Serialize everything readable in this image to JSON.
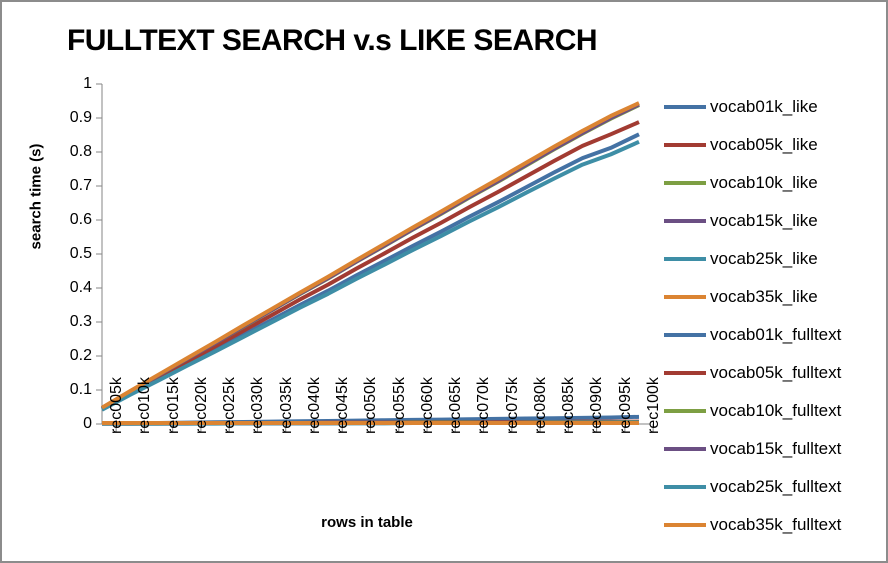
{
  "chart_data": {
    "type": "line",
    "title": "FULLTEXT SEARCH v.s LIKE SEARCH",
    "xlabel": "rows in table",
    "ylabel": "search time (s)",
    "ylim": [
      0,
      1
    ],
    "ytick_labels": [
      "1",
      "0.9",
      "0.8",
      "0.7",
      "0.6",
      "0.5",
      "0.4",
      "0.3",
      "0.2",
      "0.1",
      "0"
    ],
    "ytick_values": [
      1,
      0.9,
      0.8,
      0.7,
      0.6,
      0.5,
      0.4,
      0.3,
      0.2,
      0.1,
      0
    ],
    "grid": false,
    "legend_position": "right",
    "categories": [
      "rec005k",
      "rec010k",
      "rec015k",
      "rec020k",
      "rec025k",
      "rec030k",
      "rec035k",
      "rec040k",
      "rec045k",
      "rec050k",
      "rec055k",
      "rec060k",
      "rec065k",
      "rec070k",
      "rec075k",
      "rec080k",
      "rec085k",
      "rec090k",
      "rec095k",
      "rec100k"
    ],
    "series": [
      {
        "name": "vocab01k_like",
        "color": "#4472A4",
        "values": [
          0.043,
          0.088,
          0.131,
          0.175,
          0.218,
          0.262,
          0.306,
          0.35,
          0.392,
          0.437,
          0.48,
          0.524,
          0.566,
          0.61,
          0.652,
          0.696,
          0.74,
          0.782,
          0.812,
          0.852
        ]
      },
      {
        "name": "vocab05k_like",
        "color": "#A23B32",
        "values": [
          0.045,
          0.092,
          0.137,
          0.183,
          0.228,
          0.274,
          0.32,
          0.366,
          0.41,
          0.457,
          0.502,
          0.548,
          0.592,
          0.638,
          0.682,
          0.728,
          0.774,
          0.818,
          0.852,
          0.888
        ]
      },
      {
        "name": "vocab10k_like",
        "color": "#7D9F43",
        "values": [
          0.047,
          0.096,
          0.143,
          0.191,
          0.238,
          0.286,
          0.334,
          0.382,
          0.428,
          0.477,
          0.524,
          0.572,
          0.618,
          0.666,
          0.712,
          0.76,
          0.808,
          0.854,
          0.898,
          0.938
        ]
      },
      {
        "name": "vocab15k_like",
        "color": "#6B4F83",
        "values": [
          0.047,
          0.096,
          0.143,
          0.191,
          0.238,
          0.287,
          0.335,
          0.383,
          0.429,
          0.478,
          0.525,
          0.573,
          0.62,
          0.668,
          0.714,
          0.762,
          0.81,
          0.856,
          0.9,
          0.94
        ]
      },
      {
        "name": "vocab25k_like",
        "color": "#3E8EA6",
        "values": [
          0.042,
          0.086,
          0.128,
          0.171,
          0.213,
          0.256,
          0.299,
          0.342,
          0.383,
          0.427,
          0.469,
          0.512,
          0.553,
          0.596,
          0.637,
          0.68,
          0.722,
          0.763,
          0.793,
          0.83
        ]
      },
      {
        "name": "vocab35k_like",
        "color": "#DB8432",
        "values": [
          0.048,
          0.097,
          0.145,
          0.193,
          0.241,
          0.29,
          0.338,
          0.386,
          0.433,
          0.482,
          0.53,
          0.578,
          0.625,
          0.673,
          0.72,
          0.768,
          0.816,
          0.862,
          0.906,
          0.944
        ]
      },
      {
        "name": "vocab01k_fulltext",
        "color": "#4472A4",
        "values": [
          0.002,
          0.003,
          0.003,
          0.004,
          0.005,
          0.006,
          0.007,
          0.008,
          0.009,
          0.01,
          0.011,
          0.012,
          0.013,
          0.014,
          0.015,
          0.016,
          0.017,
          0.018,
          0.019,
          0.021
        ]
      },
      {
        "name": "vocab05k_fulltext",
        "color": "#A23B32",
        "values": [
          0.001,
          0.001,
          0.002,
          0.002,
          0.002,
          0.003,
          0.003,
          0.003,
          0.004,
          0.004,
          0.004,
          0.005,
          0.005,
          0.005,
          0.006,
          0.006,
          0.006,
          0.007,
          0.007,
          0.007
        ]
      },
      {
        "name": "vocab10k_fulltext",
        "color": "#7D9F43",
        "values": [
          0.001,
          0.001,
          0.001,
          0.002,
          0.002,
          0.002,
          0.002,
          0.003,
          0.003,
          0.003,
          0.003,
          0.004,
          0.004,
          0.004,
          0.004,
          0.005,
          0.005,
          0.005,
          0.005,
          0.006
        ]
      },
      {
        "name": "vocab15k_fulltext",
        "color": "#6B4F83",
        "values": [
          0.001,
          0.001,
          0.001,
          0.001,
          0.002,
          0.002,
          0.002,
          0.002,
          0.002,
          0.003,
          0.003,
          0.003,
          0.003,
          0.003,
          0.004,
          0.004,
          0.004,
          0.004,
          0.004,
          0.005
        ]
      },
      {
        "name": "vocab25k_fulltext",
        "color": "#3E8EA6",
        "values": [
          0.001,
          0.001,
          0.001,
          0.001,
          0.001,
          0.002,
          0.002,
          0.002,
          0.002,
          0.002,
          0.002,
          0.003,
          0.003,
          0.003,
          0.003,
          0.003,
          0.004,
          0.004,
          0.004,
          0.004
        ]
      },
      {
        "name": "vocab35k_fulltext",
        "color": "#DB8432",
        "values": [
          0.003,
          0.003,
          0.003,
          0.003,
          0.003,
          0.003,
          0.003,
          0.003,
          0.003,
          0.003,
          0.003,
          0.003,
          0.003,
          0.003,
          0.003,
          0.003,
          0.003,
          0.003,
          0.003,
          0.003
        ]
      }
    ],
    "legend_entries": [
      {
        "label": "vocab01k_like",
        "color": "#4472A4"
      },
      {
        "label": "vocab05k_like",
        "color": "#A23B32"
      },
      {
        "label": "vocab10k_like",
        "color": "#7D9F43"
      },
      {
        "label": "vocab15k_like",
        "color": "#6B4F83"
      },
      {
        "label": "vocab25k_like",
        "color": "#3E8EA6"
      },
      {
        "label": "vocab35k_like",
        "color": "#DB8432"
      },
      {
        "label": "vocab01k_fulltext",
        "color": "#4472A4"
      },
      {
        "label": "vocab05k_fulltext",
        "color": "#A23B32"
      },
      {
        "label": "vocab10k_fulltext",
        "color": "#7D9F43"
      },
      {
        "label": "vocab15k_fulltext",
        "color": "#6B4F83"
      },
      {
        "label": "vocab25k_fulltext",
        "color": "#3E8EA6"
      },
      {
        "label": "vocab35k_fulltext",
        "color": "#DB8432"
      }
    ],
    "axis_color": "#868686",
    "text_color": "#000000",
    "background": "#ffffff"
  }
}
